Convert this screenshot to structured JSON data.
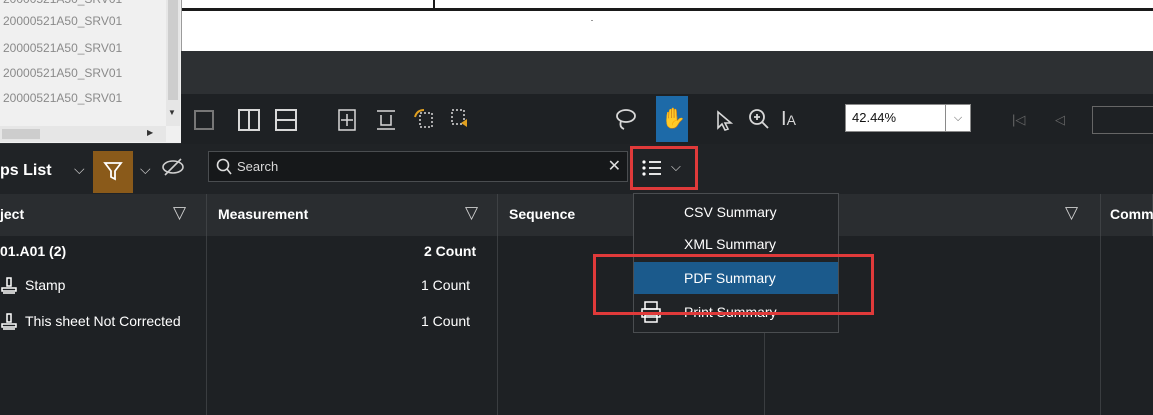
{
  "file_list": {
    "rows": [
      "20000521A50_SRV01",
      "20000521A50_SRV01",
      "20000521A50_SRV01",
      "20000521A50_SRV01",
      "20000521A50_SRV01"
    ]
  },
  "toolbar": {
    "zoom_value": "42.44%",
    "text_select_label": "A"
  },
  "list_panel": {
    "title": "ps List",
    "search_placeholder": "Search"
  },
  "table": {
    "columns": [
      "ject",
      "Measurement",
      "Sequence",
      "Comm"
    ],
    "rows": [
      {
        "subject": "01.A01 (2)",
        "measurement": "2 Count"
      },
      {
        "subject": "Stamp",
        "measurement": "1 Count"
      },
      {
        "subject": "This sheet Not Corrected",
        "measurement": "1 Count"
      }
    ]
  },
  "summary_menu": {
    "items": [
      "CSV Summary",
      "XML Summary",
      "PDF Summary",
      "Print Summary"
    ],
    "highlighted": "PDF Summary"
  },
  "colors": {
    "accent_blue": "#1d6aa8",
    "filter_orange": "#8a5a1a",
    "highlight_red": "#e03a3a"
  },
  "icons": [
    "hand-icon",
    "lasso-icon",
    "pointer-icon",
    "zoom-in-icon",
    "text-select-icon",
    "filter-icon",
    "eye-slash-icon",
    "search-icon",
    "list-icon",
    "printer-icon"
  ]
}
